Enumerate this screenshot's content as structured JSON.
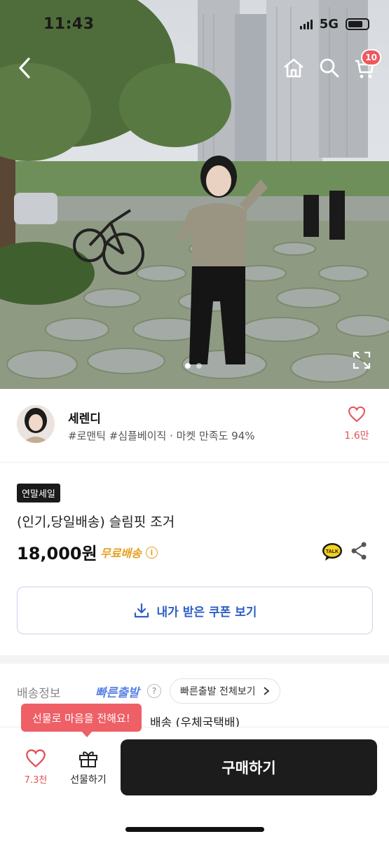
{
  "status_bar": {
    "time": "11:43",
    "network": "5G"
  },
  "header": {
    "back_icon": "chevron-left-icon",
    "home_icon": "home-icon",
    "search_icon": "search-icon",
    "cart_icon": "cart-icon",
    "cart_count": "10"
  },
  "gallery": {
    "page_index": 1,
    "page_count": 2,
    "expand_icon": "expand-icon"
  },
  "seller": {
    "name": "세렌디",
    "tags": "#로맨틱 #심플베이직 · 마켓 만족도 94%",
    "like_count": "1.6만"
  },
  "product": {
    "badge": "연말세일",
    "title": "(인기,당일배송) 슬림핏 조거",
    "price": "18,000원",
    "shipping_tag": "무료배송",
    "coupon_label": "내가 받은 쿠폰 보기"
  },
  "shipping": {
    "label": "배송정보",
    "fast_label": "빠른출발",
    "fast_all_label": "빠른출발 전체보기",
    "method": "배송 (우체국택배)"
  },
  "bottom_bar": {
    "tooltip": "선물로 마음을 전해요!",
    "like_count": "7.3천",
    "gift_label": "선물하기",
    "buy_label": "구매하기"
  },
  "colors": {
    "accent_red": "#e2535a",
    "coupon_blue": "#2d5fc4",
    "free_ship": "#e5a021",
    "buy_button": "#1c1c1c"
  }
}
